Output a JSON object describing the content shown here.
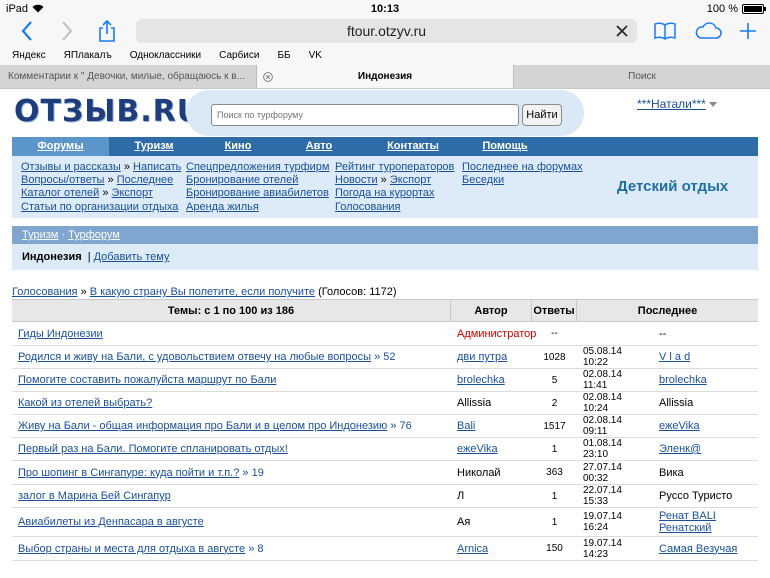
{
  "status": {
    "carrier": "iPad",
    "time": "10:13",
    "battery": "100 %",
    "battery_level": 1.0
  },
  "browser": {
    "url": "ftour.otzyv.ru"
  },
  "bookmarks": [
    "Яндекс",
    "ЯПлакалъ",
    "Одноклассники",
    "Сарбиси",
    "ББ",
    "VK"
  ],
  "tabs": [
    {
      "label": "Комментарии к \" Девочки, милые, обращаюсь к в..."
    },
    {
      "label": "Индонезия"
    },
    {
      "label": "Поиск"
    }
  ],
  "site": {
    "logo": "ОТЗЫВ.RU",
    "search_placeholder": "Поиск по турфоруму",
    "search_button": "Найти",
    "user": "***Натали***"
  },
  "menu": [
    "Форумы",
    "Туризм",
    "Кино",
    "Авто",
    "Контакты",
    "Помощь"
  ],
  "submenu": {
    "col1": [
      {
        "a": "Отзывы и рассказы",
        "sep": "»",
        "b": "Написать"
      },
      {
        "a": "Вопросы/ответы",
        "sep": "»",
        "b": "Последнее"
      },
      {
        "a": "Каталог отелей",
        "sep": "»",
        "b": "Экспорт"
      },
      {
        "a": "Статьи по организации отдыха"
      }
    ],
    "col2": [
      "Спецпредложения турфирм",
      "Бронирование отелей",
      "Бронирование авиабилетов",
      "Аренда жилья"
    ],
    "col3": [
      {
        "a": "Рейтинг туроператоров"
      },
      {
        "a": "Новости",
        "sep": "»",
        "b": "Экспорт"
      },
      {
        "a": "Погода на курортах"
      },
      {
        "a": "Голосования"
      }
    ],
    "col4": [
      "Последнее на форумах",
      "Беседки"
    ],
    "featured": "Детский отдых"
  },
  "crumbs": {
    "a": "Туризм",
    "sep": "·",
    "b": "Турфорум"
  },
  "section": {
    "title": "Индонезия",
    "sep": "|",
    "add": "Добавить тему"
  },
  "vote": {
    "a": "Голосования",
    "sep1": "»",
    "b": "В какую страну Вы полетите, если получите",
    "c": "(Голосов: 1172)"
  },
  "table": {
    "headers": [
      "Темы: с 1 по 100 из 186",
      "Автор",
      "Ответы",
      "Последнее"
    ],
    "rows": [
      {
        "title": "Гиды Индонезии",
        "pages": "",
        "author": "Администратор",
        "replies": "--",
        "date": "",
        "last": "--"
      },
      {
        "title": "Родился и живу на Бали, с удовольствием отвечу на любые вопросы",
        "pages": "» 52",
        "author": "дви путра",
        "replies": "1028",
        "date": "05.08.14 10:22",
        "last": "V l a d"
      },
      {
        "title": "Помогите составить пожалуйста маршрут по Бали",
        "pages": "",
        "author": "brolechka",
        "replies": "5",
        "date": "02.08.14 11:41",
        "last": "brolechka"
      },
      {
        "title": "Какой из отелей выбрать?",
        "pages": "",
        "author": "Allissia",
        "replies": "2",
        "date": "02.08.14 10:24",
        "last": "Allissia"
      },
      {
        "title": "Живу на Бали - общая информация про Бали и в целом про Индонезию",
        "pages": "» 76",
        "author": "Bali",
        "replies": "1517",
        "date": "02.08.14 09:11",
        "last": "ежеVika"
      },
      {
        "title": "Первый раз на Бали. Помогите спланировать отдых!",
        "pages": "",
        "author": "ежеVika",
        "replies": "1",
        "date": "01.08.14 23:10",
        "last": "Эленк@"
      },
      {
        "title": "Про шопинг в Сингапуре: куда пойти и т.п.?",
        "pages": "» 19",
        "author": "Николай",
        "replies": "363",
        "date": "27.07.14 00:32",
        "last": "Вика"
      },
      {
        "title": "залог в Марина Бей Сингапур",
        "pages": "",
        "author": "Л",
        "replies": "1",
        "date": "22.07.14 15:33",
        "last": "Руссо Туристо"
      },
      {
        "title": "Авиабилеты из Денпасара в августе",
        "pages": "",
        "author": "Ая",
        "replies": "1",
        "date": "19.07.14 16:24",
        "last": "Ренат BALI Ренатский"
      },
      {
        "title": "Выбор страны и места для отдыха в августе",
        "pages": "» 8",
        "author": "Arnica",
        "replies": "150",
        "date": "19.07.14 14:23",
        "last": "Самая Везучая"
      }
    ]
  }
}
